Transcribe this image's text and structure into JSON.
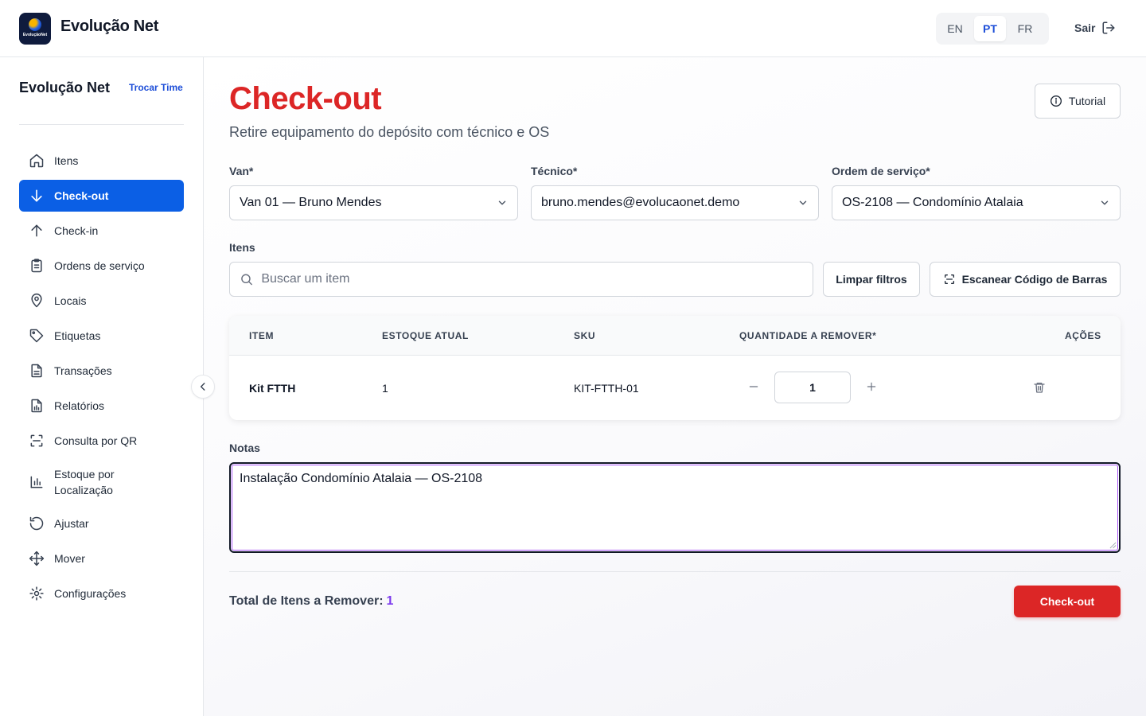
{
  "app": {
    "brand": "Evolução Net",
    "logo_text": "EvoluçãoNet"
  },
  "languages": [
    {
      "code": "EN",
      "active": false
    },
    {
      "code": "PT",
      "active": true
    },
    {
      "code": "FR",
      "active": false
    }
  ],
  "header": {
    "logout_label": "Sair"
  },
  "sidebar": {
    "team_name": "Evolução Net",
    "switch_team": "Trocar Time",
    "items": [
      {
        "label": "Itens",
        "icon": "home-icon",
        "active": false
      },
      {
        "label": "Check-out",
        "icon": "arrow-down-icon",
        "active": true
      },
      {
        "label": "Check-in",
        "icon": "arrow-up-icon",
        "active": false
      },
      {
        "label": "Ordens de serviço",
        "icon": "clipboard-icon",
        "active": false
      },
      {
        "label": "Locais",
        "icon": "map-pin-icon",
        "active": false
      },
      {
        "label": "Etiquetas",
        "icon": "tag-icon",
        "active": false
      },
      {
        "label": "Transações",
        "icon": "document-icon",
        "active": false
      },
      {
        "label": "Relatórios",
        "icon": "report-icon",
        "active": false
      },
      {
        "label": "Consulta por QR",
        "icon": "scan-icon",
        "active": false
      },
      {
        "label": "Estoque por Localização",
        "icon": "bar-chart-icon",
        "active": false
      },
      {
        "label": "Ajustar",
        "icon": "rotate-icon",
        "active": false
      },
      {
        "label": "Mover",
        "icon": "move-icon",
        "active": false
      },
      {
        "label": "Configurações",
        "icon": "gear-icon",
        "active": false
      }
    ]
  },
  "main": {
    "title": "Check-out",
    "subtitle": "Retire equipamento do depósito com técnico e OS",
    "tutorial_label": "Tutorial",
    "van": {
      "label": "Van*",
      "value": "Van 01 — Bruno Mendes"
    },
    "technician": {
      "label": "Técnico*",
      "value": "bruno.mendes@evolucaonet.demo"
    },
    "service_order": {
      "label": "Ordem de serviço*",
      "value": "OS-2108 — Condomínio Atalaia"
    },
    "items_label": "Itens",
    "search_placeholder": "Buscar um item",
    "clear_filters": "Limpar filtros",
    "scan_barcode": "Escanear Código de Barras",
    "table": {
      "columns": [
        "ITEM",
        "ESTOQUE ATUAL",
        "SKU",
        "QUANTIDADE A REMOVER*",
        "AÇÕES"
      ],
      "rows": [
        {
          "item": "Kit FTTH",
          "stock": "1",
          "sku": "KIT-FTTH-01",
          "quantity": "1"
        }
      ]
    },
    "notes_label": "Notas",
    "notes_value": "Instalação Condomínio Atalaia — OS-2108",
    "total_label": "Total de Itens a Remover:",
    "total_value": "1",
    "checkout_button": "Check-out"
  },
  "colors": {
    "primary": "#0b5fe5",
    "danger": "#dc2626",
    "accent_purple": "#7c3aed"
  }
}
